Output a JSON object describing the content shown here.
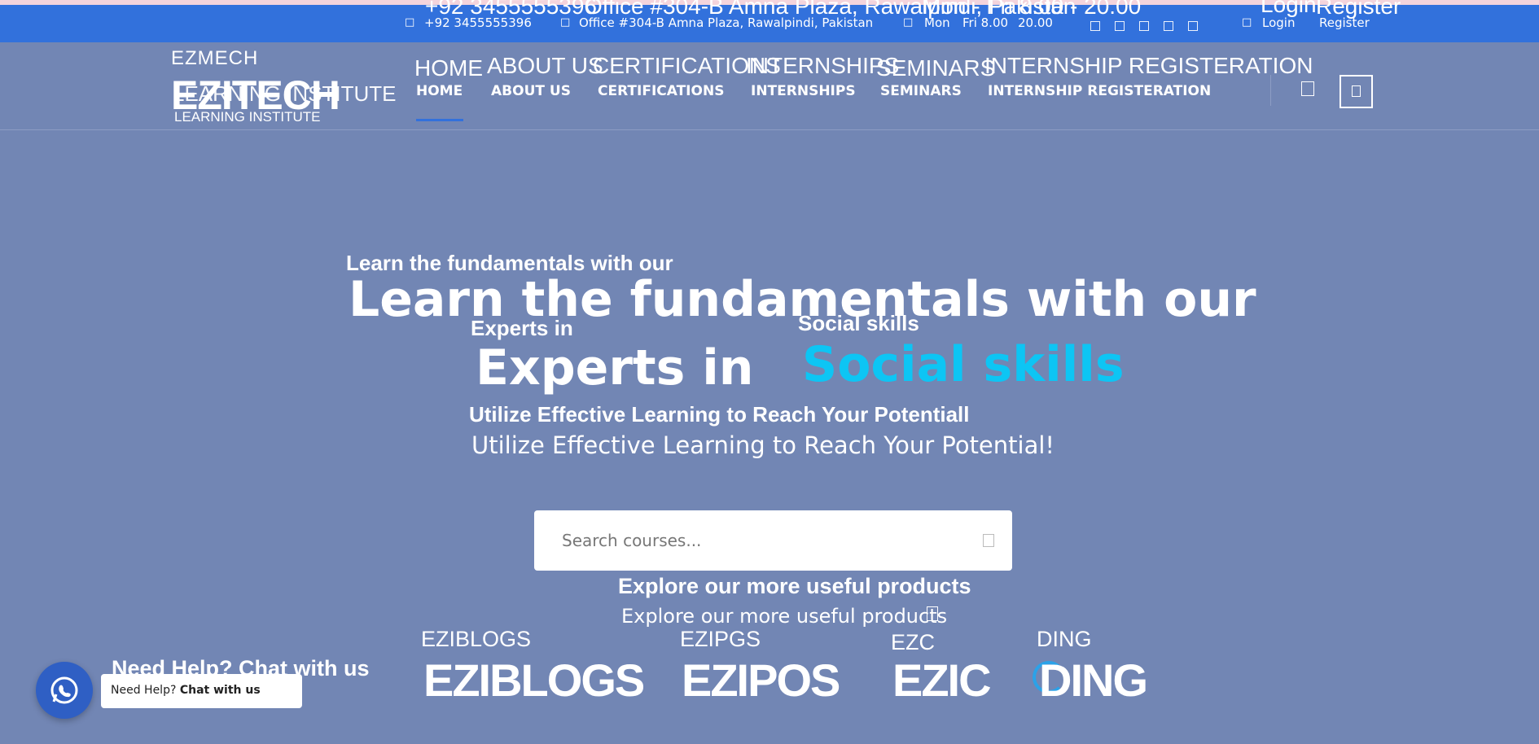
{
  "topbar": {
    "ghost_phone": "+92 3455555396",
    "ghost_office": "Office #304-B Amna Plaza, Rawalpindi, Pakistan",
    "ghost_hours": "Mon - Fri 8.00 - 20.00",
    "ghost_login": "Login",
    "ghost_register": "Register",
    "phone": "+92 3455555396",
    "office": "Office #304-B Amna Plaza, Rawalpindi, Pakistan",
    "hours_day": "Mon",
    "hours_range_start": "Fri 8.00",
    "hours_range_end": "20.00",
    "login": "Login",
    "register": "Register",
    "icon_glyph": "□"
  },
  "logo": {
    "small": "EZMECH",
    "main": "EZITECH",
    "tagline_ghost": "LEARNING INSTITUTE",
    "tagline": "LEARNING INSTITUTE"
  },
  "nav": {
    "ghost": [
      "HOME",
      "ABOUT US",
      "CERTIFICATIONS",
      "INTERNSHIPS",
      "SEMINARS",
      "INTERNSHIP REGISTERATION"
    ],
    "items": [
      "HOME",
      "ABOUT US",
      "CERTIFICATIONS",
      "INTERNSHIPS",
      "SEMINARS",
      "INTERNSHIP REGISTERATION"
    ]
  },
  "hero": {
    "title_ghost": "Learn the fundamentals with our",
    "title": "Learn the fundamentals with our",
    "sub1_ghost": "Experts in",
    "sub1": "Experts in",
    "sub2_ghost": "Social skills",
    "sub2": "Social skills",
    "desc_ghost": "Utilize Effective Learning to Reach Your Potentiall",
    "desc": "Utilize Effective Learning to Reach Your Potential!",
    "search_placeholder": "Search courses..."
  },
  "products": {
    "explore_ghost": "Explore our more useful products",
    "explore": "Explore our more useful products",
    "ghosts": [
      "EZIBLOGS",
      "EZIPGS",
      "EZC",
      "DING"
    ],
    "items": [
      "EZIBLOGS",
      "EZIPOS",
      "EZIC",
      "DING"
    ]
  },
  "chat": {
    "ghost": "Need Help? Chat with us",
    "prefix": "Need Help?",
    "strong": "Chat with us"
  },
  "colors": {
    "background": "#7286b4",
    "topbar": "#3271dc",
    "accent": "#0dc5f4"
  }
}
